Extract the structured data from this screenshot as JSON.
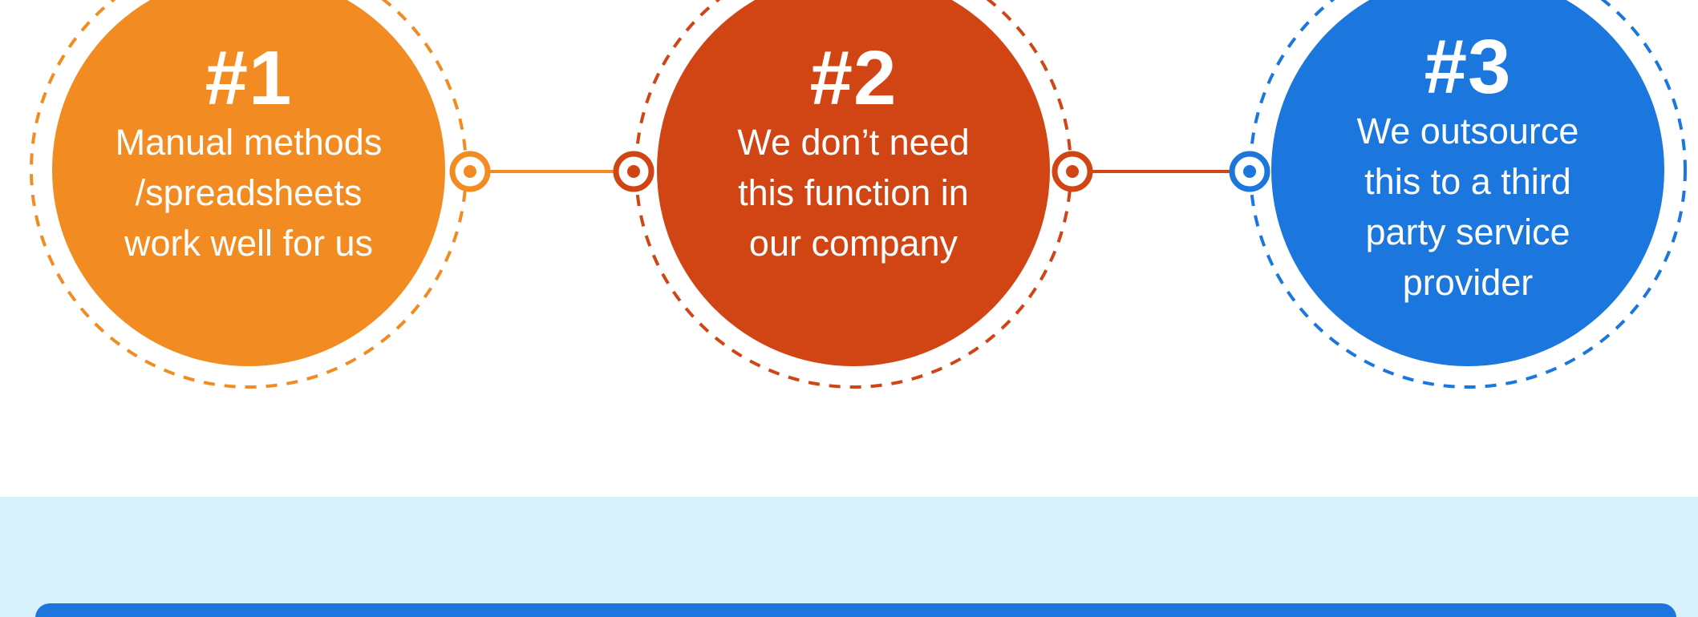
{
  "colors": {
    "orange": "#f28c22",
    "red_orange": "#d04513",
    "blue": "#1b76de",
    "band_background": "#d8f1fb",
    "white": "#ffffff"
  },
  "items": [
    {
      "number": "#1",
      "text": "Manual methods\n/spreadsheets\nwork well for us",
      "color": "#f28c22"
    },
    {
      "number": "#2",
      "text": "We don’t need\nthis function in\nour company",
      "color": "#d04513"
    },
    {
      "number": "#3",
      "text": "We outsource\nthis to a third\nparty service\nprovider",
      "color": "#1b76de"
    }
  ],
  "connectors": [
    {
      "from": "#1",
      "to": "#2",
      "line_color": "#f28c22",
      "left_node_color": "#f28c22",
      "right_node_color": "#d04513"
    },
    {
      "from": "#2",
      "to": "#3",
      "line_color": "#d04513",
      "left_node_color": "#d04513",
      "right_node_color": "#1b76de"
    }
  ]
}
